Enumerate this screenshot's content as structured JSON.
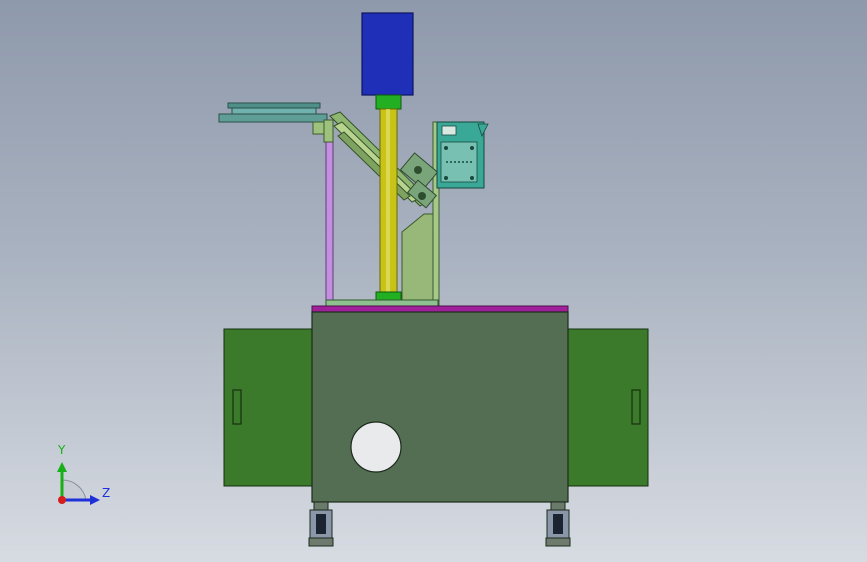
{
  "colors": {
    "motor": "#1f2fb8",
    "column": "#c8c417",
    "collar": "#22b022",
    "cabinet_body": "#536e52",
    "side_door": "#3a7a2a",
    "top_plate": "#a01f9a",
    "frame_purple": "#b97ad6",
    "bracket_green": "#92b46a",
    "control_box": "#3aa896",
    "axis_x": "#d41e1e",
    "axis_y": "#18b018",
    "axis_z": "#2030d8"
  },
  "axes": {
    "y_label": "Y",
    "z_label": "Z"
  },
  "icons": {
    "triad": "coordinate-triad-icon"
  }
}
